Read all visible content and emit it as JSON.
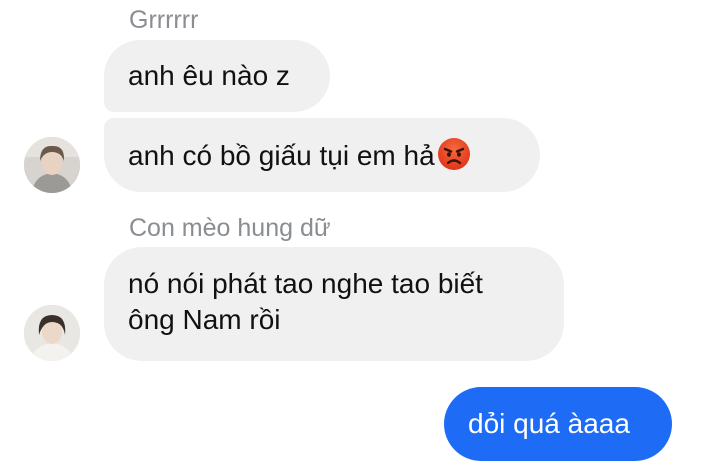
{
  "conversation": {
    "groups": [
      {
        "sender_name": "Grrrrrr",
        "messages": [
          {
            "text": "anh êu nào z"
          },
          {
            "text": "anh có bồ giấu tụi em hả",
            "trailing_emoji": "angry-face-emoji"
          }
        ]
      },
      {
        "sender_name": "Con mèo hung dữ",
        "messages": [
          {
            "line1": "nó nói phát tao nghe tao biết",
            "line2": "ông Nam rồi"
          }
        ]
      }
    ],
    "outgoing": [
      {
        "text": "dỏi quá àaaa"
      }
    ]
  },
  "colors": {
    "incoming_bubble": "#f0f0f0",
    "outgoing_bubble": "#1e6cf6",
    "sender_name": "#8a8d91"
  }
}
